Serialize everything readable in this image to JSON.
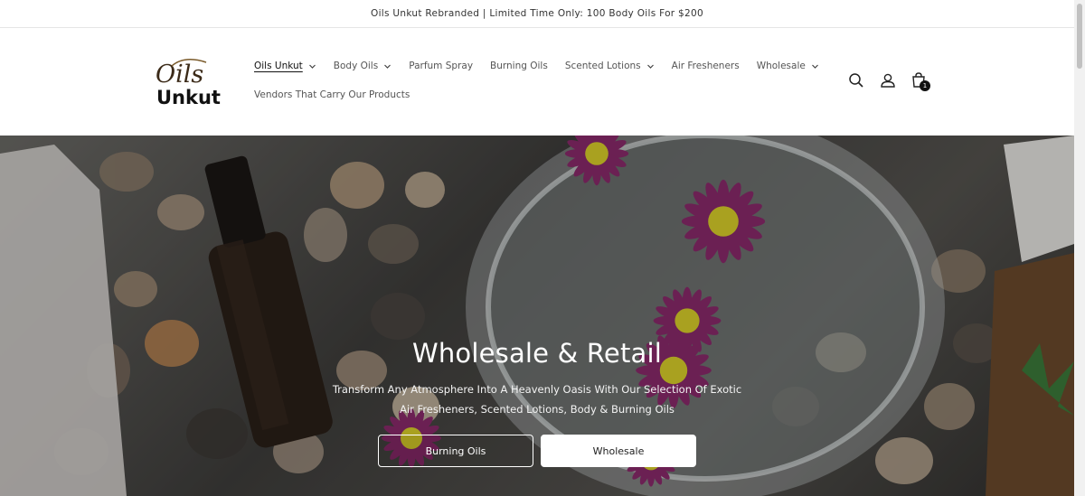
{
  "announcement": "Oils Unkut Rebranded | Limited Time Only: 100 Body Oils For $200",
  "logo": {
    "line1": "Oils",
    "line2": "Unkut"
  },
  "nav": {
    "row1": [
      {
        "label": "Oils Unkut",
        "dropdown": true,
        "active": true
      },
      {
        "label": "Body Oils",
        "dropdown": true
      },
      {
        "label": "Parfum Spray",
        "dropdown": false
      },
      {
        "label": "Burning Oils",
        "dropdown": false
      },
      {
        "label": "Scented Lotions",
        "dropdown": true
      },
      {
        "label": "Air Fresheners",
        "dropdown": false
      },
      {
        "label": "Wholesale",
        "dropdown": true
      }
    ],
    "row2": [
      {
        "label": "Vendors That Carry Our Products",
        "dropdown": false
      }
    ]
  },
  "header_icons": {
    "search": "search-icon",
    "account": "account-icon",
    "cart": "cart-icon",
    "cart_count": "1"
  },
  "hero": {
    "title": "Wholesale & Retail",
    "subtitle": "Transform Any Atmosphere Into A Heavenly Oasis With Our Selection Of Exotic Air Fresheners, Scented Lotions, Body & Burning Oils",
    "button_primary": "Burning Oils",
    "button_secondary": "Wholesale"
  },
  "colors": {
    "accent": "#111111",
    "flower": "#8a2a6b",
    "flower_center": "#d9cf2a"
  }
}
